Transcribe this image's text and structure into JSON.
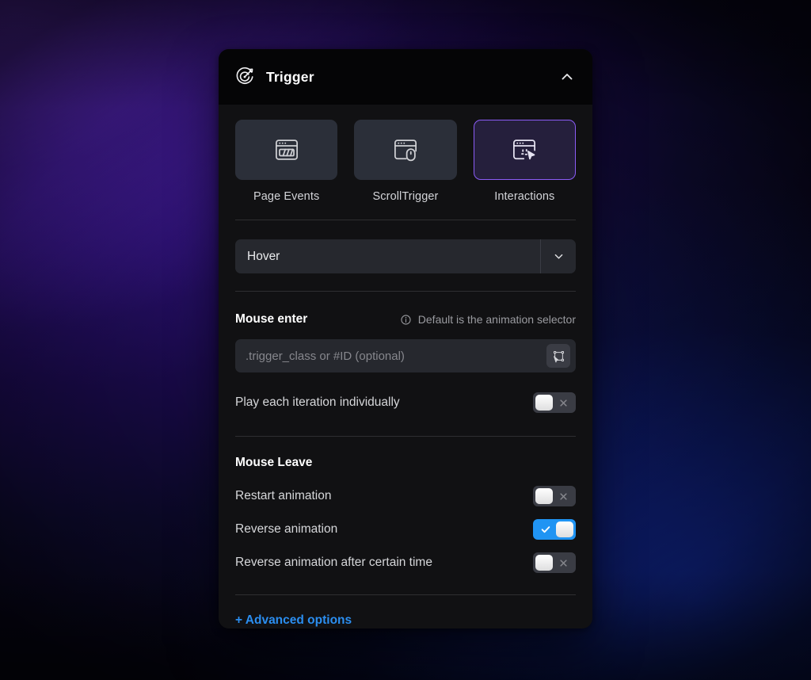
{
  "panel": {
    "header": {
      "icon": "target-arrow-icon",
      "title": "Trigger",
      "collapse_icon": "chevron-up-icon"
    },
    "tabs": [
      {
        "label": "Page Events",
        "icon": "browser-bars-icon",
        "selected": false
      },
      {
        "label": "ScrollTrigger",
        "icon": "browser-mouse-icon",
        "selected": false
      },
      {
        "label": "Interactions",
        "icon": "browser-cursor-icon",
        "selected": true
      }
    ],
    "event_select": {
      "value": "Hover",
      "icon": "chevron-down-icon"
    },
    "mouse_enter": {
      "title": "Mouse enter",
      "hint_icon": "info-icon",
      "hint": "Default is the animation selector",
      "selector_input": {
        "value": "",
        "placeholder": ".trigger_class or #ID (optional)"
      },
      "picker_icon": "element-picker-icon",
      "options": [
        {
          "label": "Play each iteration individually",
          "state": "off"
        }
      ]
    },
    "mouse_leave": {
      "title": "Mouse Leave",
      "options": [
        {
          "label": "Restart animation",
          "state": "off"
        },
        {
          "label": "Reverse animation",
          "state": "on"
        },
        {
          "label": "Reverse animation after certain time",
          "state": "off"
        }
      ]
    },
    "advanced_options": "+ Advanced options"
  },
  "colors": {
    "accent_purple": "#8b5cf6",
    "accent_blue": "#2b8ef0",
    "toggle_on": "#2094f3",
    "panel_bg": "#111113",
    "header_bg": "#050506"
  }
}
